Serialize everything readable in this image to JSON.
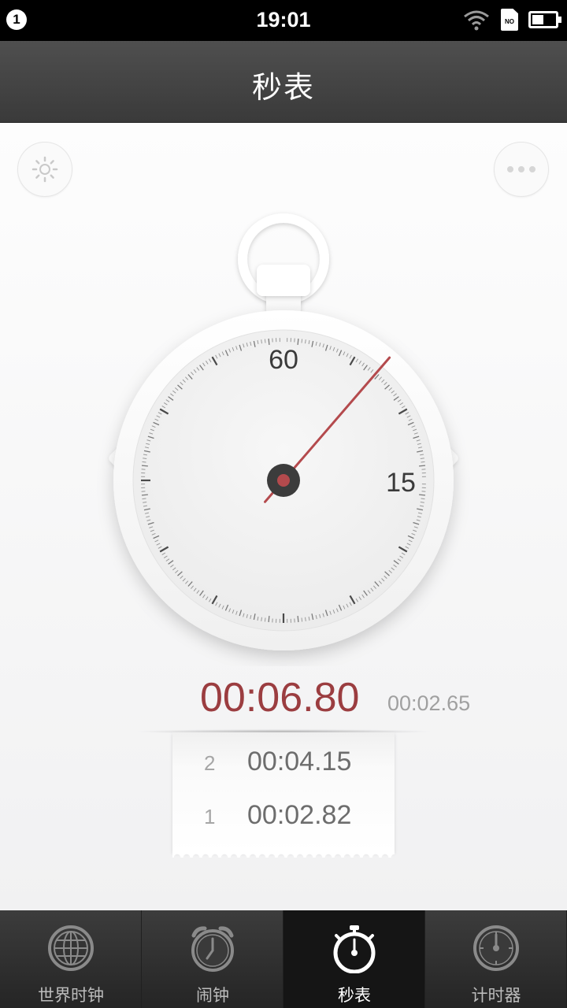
{
  "status_bar": {
    "notification_count": "1",
    "time": "19:01",
    "sim_label": "NO",
    "icons": [
      "wifi-icon",
      "sim-icon",
      "battery-icon"
    ]
  },
  "header": {
    "title": "秒表"
  },
  "toolbar": {
    "left_icon": "settings-icon",
    "right_icon": "more-icon"
  },
  "dial": {
    "label_top": "60",
    "label_right": "15",
    "hand_seconds": 6.8,
    "accent_color": "#b44a4d"
  },
  "stopwatch": {
    "elapsed": "00:06.80",
    "current_lap": "00:02.65"
  },
  "laps": [
    {
      "number": "2",
      "time": "00:04.15"
    },
    {
      "number": "1",
      "time": "00:02.82"
    }
  ],
  "tabs": [
    {
      "label": "世界时钟",
      "icon": "globe-icon",
      "active": false
    },
    {
      "label": "闹钟",
      "icon": "alarm-clock-icon",
      "active": false
    },
    {
      "label": "秒表",
      "icon": "stopwatch-icon",
      "active": true
    },
    {
      "label": "计时器",
      "icon": "timer-icon",
      "active": false
    }
  ]
}
